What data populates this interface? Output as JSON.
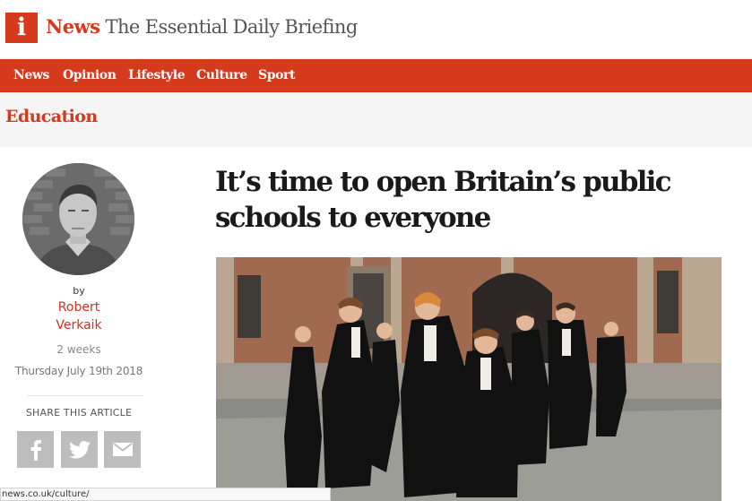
{
  "masthead": {
    "logo_letter": "i",
    "brand_name": "News",
    "tagline": " The Essential Daily Briefing"
  },
  "nav": {
    "items": [
      "News",
      "Opinion",
      "Lifestyle",
      "Culture",
      "Sport"
    ]
  },
  "section": {
    "title": "Education"
  },
  "author": {
    "by_label": "by",
    "name_first": "Robert",
    "name_last": "Verkaik",
    "time_ago": "2 weeks",
    "date": "Thursday July 19th 2018"
  },
  "share": {
    "label": "SHARE THIS ARTICLE",
    "buttons": [
      "facebook-icon",
      "twitter-icon",
      "email-icon"
    ]
  },
  "article": {
    "headline_line1": "It’s time to open Britain’s public",
    "headline_line2": "schools to everyone"
  },
  "status_bar": {
    "url": "news.co.uk/culture/"
  },
  "colors": {
    "brand_red": "#d43a1b",
    "share_grey": "#bdbdbd",
    "section_bg": "#f5f5f5"
  }
}
